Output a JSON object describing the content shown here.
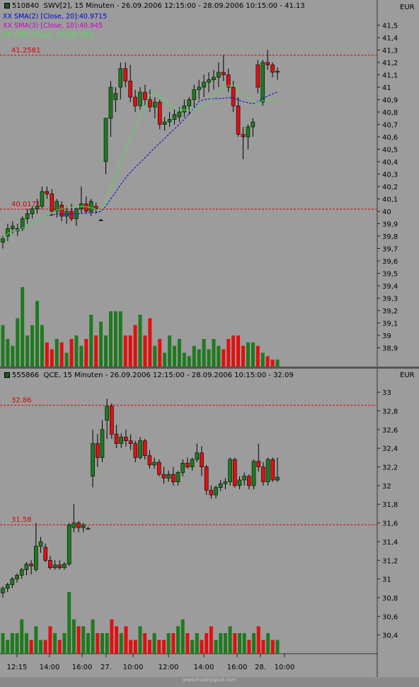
{
  "panel1": {
    "symbol": "510840",
    "title": "SWV[2], 15 Minuten - 26.09.2006 12:15:00 - 28.09.2006 10:15:00 - 41.13",
    "currency": "EUR",
    "indicators": [
      {
        "label": "XX SMA(2) [Close, 20]:40.9715",
        "color": "#0000dd"
      },
      {
        "label": "XX SMA(3) [Close, 10]:40.945",
        "color": "#cc00cc"
      },
      {
        "label": "XX SMA [Close, 10]:40.945",
        "color": "#55dd55"
      }
    ],
    "ref_lines": [
      {
        "value": 41.2581,
        "label": "41.2581"
      },
      {
        "value": 40.0171,
        "label": "40.0171"
      }
    ]
  },
  "panel2": {
    "symbol": "555866",
    "title": "QCE, 15 Minuten - 26.09.2006 12:15:00 - 28.09.2006 10:15:00 - 32.09",
    "currency": "EUR",
    "ref_lines": [
      {
        "value": 32.86,
        "label": "32.86"
      },
      {
        "value": 31.58,
        "label": "31.58"
      }
    ]
  },
  "watermark": "www.tradesignal.com",
  "colors": {
    "up": "#1f7a1f",
    "down": "#e01010",
    "background": "#9c9c9c",
    "ref_line": "#dd0000",
    "sma20": "#0000dd",
    "sma10": "#55dd55"
  },
  "chart_data": [
    {
      "type": "candlestick",
      "title": "SWV[2], 15 Minuten - 26.09.2006 12:15:00 - 28.09.2006 10:15:00 - 41.13",
      "ylim": [
        38.8,
        41.6
      ],
      "y_ticks": [
        38.9,
        39,
        39.1,
        39.2,
        39.3,
        39.4,
        39.5,
        39.6,
        39.7,
        39.8,
        39.9,
        40,
        40.1,
        40.2,
        40.3,
        40.4,
        40.5,
        40.6,
        40.7,
        40.8,
        40.9,
        41,
        41.1,
        41.2,
        41.3,
        41.4,
        41.5
      ],
      "y_tick_labels": [
        "38,9",
        "39",
        "39,1",
        "39,2",
        "39,3",
        "39,4",
        "39,5",
        "39,6",
        "39,7",
        "39,8",
        "39,9",
        "40",
        "40,1",
        "40,2",
        "40,3",
        "40,4",
        "40,5",
        "40,6",
        "40,7",
        "40,8",
        "40,9",
        "41",
        "41,1",
        "41,2",
        "41,3",
        "41,4",
        "41,5"
      ],
      "ohlc": [
        [
          39.75,
          39.8,
          39.7,
          39.78
        ],
        [
          39.8,
          39.9,
          39.76,
          39.86
        ],
        [
          39.86,
          39.92,
          39.82,
          39.88
        ],
        [
          39.84,
          39.9,
          39.8,
          39.86
        ],
        [
          39.86,
          39.96,
          39.84,
          39.94
        ],
        [
          39.94,
          40.02,
          39.9,
          39.98
        ],
        [
          39.98,
          40.04,
          39.94,
          40.02
        ],
        [
          40.02,
          40.1,
          39.98,
          40.04
        ],
        [
          40.04,
          40.2,
          40.02,
          40.16
        ],
        [
          40.16,
          40.2,
          40.1,
          40.14
        ],
        [
          40.14,
          40.18,
          39.96,
          40.0
        ],
        [
          40,
          40.1,
          39.95,
          40.08
        ],
        [
          40.05,
          40.08,
          39.92,
          39.96
        ],
        [
          39.96,
          40.04,
          39.9,
          40.0
        ],
        [
          40.0,
          40.06,
          39.92,
          39.94
        ],
        [
          39.94,
          40.03,
          39.88,
          40.02
        ],
        [
          40.02,
          40.2,
          39.98,
          40.06
        ],
        [
          40.06,
          40.12,
          39.98,
          40.0
        ],
        [
          40,
          40.1,
          39.96,
          40.08
        ],
        [
          40.04,
          40.07,
          39.98,
          40.02
        ],
        [
          39.93,
          39.94,
          39.92,
          39.93
        ],
        [
          40.4,
          40.5,
          40.3,
          40.75
        ],
        [
          40.75,
          41.05,
          40.6,
          41.0
        ],
        [
          40.9,
          41.0,
          40.8,
          40.95
        ],
        [
          41.0,
          41.2,
          40.9,
          41.15
        ],
        [
          41.15,
          41.2,
          41.0,
          41.05
        ],
        [
          41.05,
          41.18,
          40.88,
          40.92
        ],
        [
          40.92,
          40.98,
          40.8,
          40.85
        ],
        [
          40.85,
          41.0,
          40.82,
          40.96
        ],
        [
          40.96,
          41.02,
          40.85,
          40.9
        ],
        [
          40.9,
          40.98,
          40.8,
          40.84
        ],
        [
          40.84,
          40.92,
          40.75,
          40.88
        ],
        [
          40.88,
          40.9,
          40.66,
          40.7
        ],
        [
          40.7,
          40.76,
          40.65,
          40.72
        ],
        [
          40.72,
          40.8,
          40.68,
          40.74
        ],
        [
          40.74,
          40.82,
          40.7,
          40.78
        ],
        [
          40.76,
          40.84,
          40.72,
          40.8
        ],
        [
          40.8,
          40.9,
          40.76,
          40.85
        ],
        [
          40.85,
          40.92,
          40.78,
          40.9
        ],
        [
          40.9,
          41.02,
          40.84,
          40.98
        ],
        [
          40.98,
          41.06,
          40.9,
          41.0
        ],
        [
          41.0,
          41.1,
          40.92,
          41.04
        ],
        [
          41.04,
          41.12,
          40.96,
          41.06
        ],
        [
          41.06,
          41.14,
          40.98,
          41.08
        ],
        [
          41.08,
          41.2,
          41.0,
          41.12
        ],
        [
          41.12,
          41.26,
          41.05,
          41.1
        ],
        [
          41.1,
          41.15,
          40.96,
          41.0
        ],
        [
          41.0,
          41.05,
          40.8,
          40.85
        ],
        [
          40.85,
          40.92,
          40.6,
          40.62
        ],
        [
          40.62,
          40.68,
          40.42,
          40.6
        ],
        [
          40.6,
          40.7,
          40.5,
          40.68
        ],
        [
          40.68,
          40.75,
          40.6,
          40.72
        ],
        [
          41.18,
          41.22,
          40.95,
          41.0
        ],
        [
          40.88,
          41.22,
          40.85,
          41.2
        ],
        [
          41.2,
          41.3,
          41.14,
          41.18
        ],
        [
          41.18,
          41.2,
          41.08,
          41.12
        ],
        [
          41.12,
          41.16,
          41.06,
          41.13
        ]
      ],
      "volumes": [
        12,
        8,
        6,
        14,
        23,
        9,
        12,
        19,
        12,
        7,
        5,
        8,
        7,
        4,
        8,
        9,
        6,
        8,
        15,
        9,
        13,
        9,
        16,
        16,
        16,
        9,
        9,
        12,
        15,
        9,
        14,
        6,
        8,
        4,
        9,
        6,
        8,
        4,
        3,
        6,
        5,
        8,
        5,
        8,
        6,
        5,
        8,
        9,
        9,
        6,
        7,
        7,
        6,
        4,
        3,
        2,
        2
      ]
    },
    {
      "type": "candlestick",
      "title": "QCE, 15 Minuten - 26.09.2006 12:15:00 - 28.09.2006 10:15:00 - 32.09",
      "ylim": [
        30.2,
        33.1
      ],
      "y_ticks": [
        30.4,
        30.6,
        30.8,
        31,
        31.2,
        31.4,
        31.6,
        31.8,
        32,
        32.2,
        32.4,
        32.6,
        32.8,
        33
      ],
      "y_tick_labels": [
        "30,4",
        "30,6",
        "30,8",
        "31",
        "31,2",
        "31,4",
        "31,6",
        "31,8",
        "32",
        "32,2",
        "32,4",
        "32,6",
        "32,8",
        "33"
      ],
      "x_tick_labels": [
        "12:15",
        "14:00",
        "16:00",
        "27.",
        "10:00",
        "12:00",
        "14:00",
        "16:00",
        "28.",
        "10:00"
      ],
      "ohlc": [
        [
          30.85,
          30.92,
          30.8,
          30.9
        ],
        [
          30.9,
          30.96,
          30.86,
          30.94
        ],
        [
          30.94,
          31.02,
          30.9,
          31.0
        ],
        [
          31.0,
          31.06,
          30.96,
          31.04
        ],
        [
          31.04,
          31.12,
          31.0,
          31.1
        ],
        [
          31.1,
          31.18,
          31.04,
          31.16
        ],
        [
          31.16,
          31.2,
          31.05,
          31.14
        ],
        [
          31.1,
          31.6,
          31.08,
          31.35
        ],
        [
          31.35,
          31.45,
          31.28,
          31.4
        ],
        [
          31.34,
          31.38,
          31.18,
          31.2
        ],
        [
          31.2,
          31.25,
          31.1,
          31.12
        ],
        [
          31.12,
          31.2,
          31.1,
          31.15
        ],
        [
          31.15,
          31.2,
          31.1,
          31.12
        ],
        [
          31.12,
          31.18,
          31.1,
          31.16
        ],
        [
          31.16,
          31.6,
          31.14,
          31.58
        ],
        [
          31.55,
          31.8,
          31.5,
          31.6
        ],
        [
          31.6,
          31.62,
          31.5,
          31.55
        ],
        [
          31.55,
          31.6,
          31.5,
          31.58
        ],
        [
          31.54,
          31.56,
          31.53,
          31.54
        ],
        [
          32.1,
          32.6,
          31.98,
          32.45
        ],
        [
          32.45,
          32.55,
          32.2,
          32.3
        ],
        [
          32.3,
          32.7,
          32.25,
          32.6
        ],
        [
          32.7,
          32.93,
          32.5,
          32.85
        ],
        [
          32.85,
          32.88,
          32.5,
          32.55
        ],
        [
          32.55,
          32.65,
          32.4,
          32.45
        ],
        [
          32.45,
          32.56,
          32.4,
          32.52
        ],
        [
          32.52,
          32.6,
          32.42,
          32.48
        ],
        [
          32.48,
          32.55,
          32.38,
          32.45
        ],
        [
          32.45,
          32.48,
          32.25,
          32.3
        ],
        [
          32.3,
          32.52,
          32.28,
          32.48
        ],
        [
          32.48,
          32.5,
          32.28,
          32.32
        ],
        [
          32.32,
          32.38,
          32.18,
          32.22
        ],
        [
          32.22,
          32.3,
          32.18,
          32.25
        ],
        [
          32.25,
          32.28,
          32.1,
          32.12
        ],
        [
          32.12,
          32.2,
          32.02,
          32.08
        ],
        [
          32.08,
          32.16,
          32.04,
          32.12
        ],
        [
          32.12,
          32.2,
          32.0,
          32.04
        ],
        [
          32.04,
          32.16,
          32.0,
          32.14
        ],
        [
          32.14,
          32.28,
          32.1,
          32.24
        ],
        [
          32.24,
          32.3,
          32.18,
          32.2
        ],
        [
          32.2,
          32.3,
          32.16,
          32.28
        ],
        [
          32.28,
          32.45,
          32.25,
          32.35
        ],
        [
          32.35,
          32.42,
          32.1,
          32.2
        ],
        [
          32.2,
          32.22,
          31.9,
          31.95
        ],
        [
          31.95,
          32.0,
          31.86,
          31.9
        ],
        [
          31.9,
          32.0,
          31.86,
          31.98
        ],
        [
          31.98,
          32.06,
          31.94,
          32.02
        ],
        [
          32.02,
          32.08,
          31.96,
          32.04
        ],
        [
          32.04,
          32.3,
          32.0,
          32.28
        ],
        [
          32.28,
          32.3,
          31.98,
          32.0
        ],
        [
          32.0,
          32.1,
          31.96,
          32.06
        ],
        [
          32.06,
          32.14,
          32.0,
          32.1
        ],
        [
          32.1,
          32.12,
          31.96,
          32.0
        ],
        [
          32.0,
          32.28,
          31.96,
          32.26
        ],
        [
          32.26,
          32.45,
          32.15,
          32.2
        ],
        [
          32.2,
          32.25,
          32.0,
          32.04
        ],
        [
          32.04,
          32.3,
          32.0,
          32.28
        ],
        [
          32.28,
          32.3,
          32.04,
          32.06
        ],
        [
          32.06,
          32.3,
          32.04,
          32.09
        ]
      ],
      "volumes": [
        3,
        2,
        3,
        3,
        5,
        3,
        2,
        4,
        2,
        2,
        4,
        3,
        2,
        3,
        9,
        5,
        4,
        4,
        3,
        5,
        3,
        3,
        3,
        5,
        4,
        3,
        4,
        2,
        2,
        4,
        3,
        2,
        3,
        2,
        2,
        3,
        3,
        4,
        5,
        3,
        2,
        3,
        2,
        3,
        4,
        2,
        3,
        3,
        4,
        3,
        3,
        3,
        2,
        3,
        4,
        2,
        3,
        2,
        2
      ]
    }
  ]
}
